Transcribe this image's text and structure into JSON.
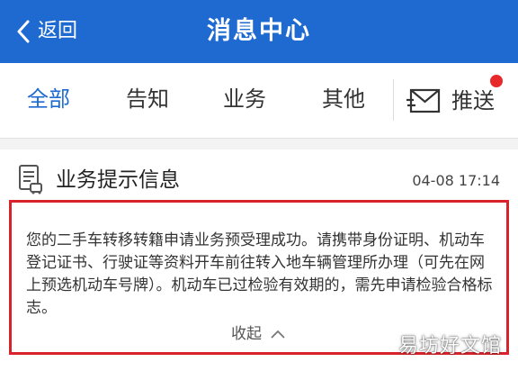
{
  "header": {
    "back_label": "返回",
    "title": "消息中心",
    "background_color": "#1f6ad1"
  },
  "tabs": {
    "items": [
      {
        "label": "全部",
        "active": true
      },
      {
        "label": "告知",
        "active": false
      },
      {
        "label": "业务",
        "active": false
      },
      {
        "label": "其他",
        "active": false
      }
    ],
    "push": {
      "label": "推送",
      "icon": "envelope-icon",
      "has_unread_dot": true
    },
    "active_color": "#1f6ad1",
    "unread_dot_color": "#e8292b"
  },
  "message": {
    "icon": "document-icon",
    "title": "业务提示信息",
    "time": "04-08 17:14",
    "body": "您的二手车转移转籍申请业务预受理成功。请携带身份证明、机动车登记证书、行驶证等资料开车前往转入地车辆管理所办理（可先在网上预选机动车号牌）。机动车已过检验有效期的，需先申请检验合格标志。",
    "collapse_label": "收起",
    "highlight_color": "#d8232a"
  },
  "watermark": {
    "text": "易坊好文馆"
  }
}
